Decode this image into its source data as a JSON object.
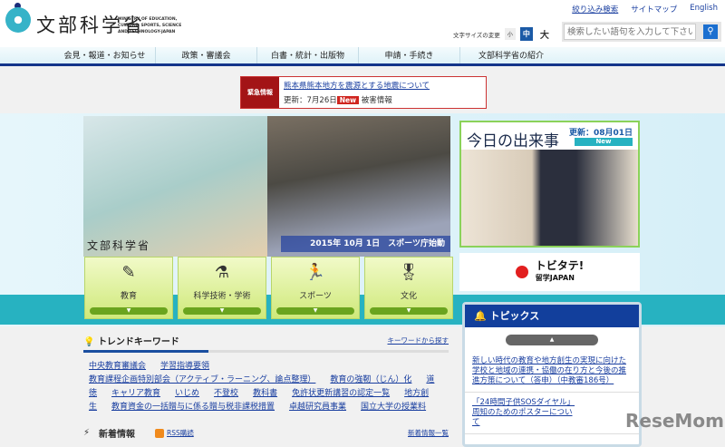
{
  "header": {
    "logo_jp": "文部科学省",
    "logo_en": "MINISTRY OF EDUCATION, CULTURE, SPORTS, SCIENCE AND TECHNOLOGY-JAPAN",
    "util_links": [
      "絞り込み検索",
      "サイトマップ",
      "English"
    ],
    "font_size_label": "文字サイズの変更",
    "font_sizes": [
      "小",
      "中",
      "大"
    ],
    "search_placeholder": "検索したい語句を入力して下さい"
  },
  "nav": [
    "会見・報道・お知らせ",
    "政策・審議会",
    "白書・統計・出版物",
    "申請・手続き",
    "文部科学省の紹介"
  ],
  "alert": {
    "tag": "緊急情報",
    "link": "熊本県熊本地方を震源とする地震について",
    "update": "更新：7月26日",
    "new": "New",
    "suffix": "被害情報"
  },
  "hero": {
    "logo": "文部科学省",
    "caption": "2015年 10月 1日　スポーツ庁始動"
  },
  "tiles": [
    {
      "label": "教育",
      "icon": "✎"
    },
    {
      "label": "科学技術・学術",
      "icon": "⚗"
    },
    {
      "label": "スポーツ",
      "icon": "🏃"
    },
    {
      "label": "文化",
      "icon": "🎖"
    }
  ],
  "today": {
    "title": "今日の出来事",
    "date": "更新：08月01日",
    "new": "New"
  },
  "tobitate": {
    "title": "トビタテ!",
    "sub": "留学JAPAN"
  },
  "topics": {
    "title": "トピックス",
    "items": [
      "新しい時代の教育や地方創生の実現に向けた学校と地域の連携・協働の在り方と今後の推進方策について（答申）（中教審186号）",
      "「24時間子供SOSダイヤル」周知のためのポスターについて"
    ]
  },
  "trend": {
    "title": "トレンドキーワード",
    "more": "キーワードから探す",
    "keywords": [
      "中央教育審議会",
      "学習指導要領",
      "教育課程企画特別部会（アクティブ・ラーニング、論点整理）",
      "教育の強靭（じん）化",
      "道徳",
      "キャリア教育",
      "いじめ",
      "不登校",
      "教科書",
      "免許状更新講習の認定一覧",
      "地方創生",
      "教育資金の一括贈与に係る贈与税非課税措置",
      "卓越研究員事業",
      "国立大学の授業料"
    ]
  },
  "news": {
    "title": "新着情報",
    "rss": "RSS購読",
    "more": "新着情報一覧"
  },
  "watermark": "ReseMom"
}
